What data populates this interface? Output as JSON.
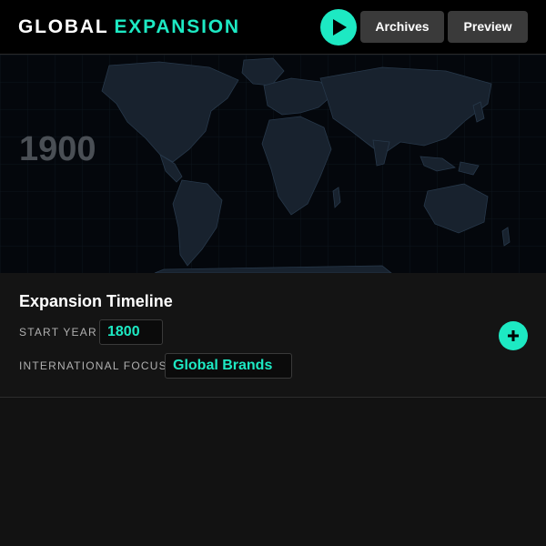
{
  "header": {
    "logo_word1": "GLOBAL",
    "logo_word2": "EXPANSION",
    "play_icon": "play-icon",
    "archives_label": "Archives",
    "preview_label": "Preview"
  },
  "map": {
    "year": "1900"
  },
  "timeline": {
    "title": "Expansion Timeline",
    "start_year_label": "START YEAR",
    "start_year_value": "1800",
    "focus_label": "INTERNATIONAL FOCUS",
    "focus_value": "Global Brands",
    "add_icon": "plus-icon"
  },
  "colors": {
    "accent": "#1de9c3",
    "header_bg": "#000000",
    "panel_bg": "#141414",
    "button_bg": "#3a3a3a"
  }
}
